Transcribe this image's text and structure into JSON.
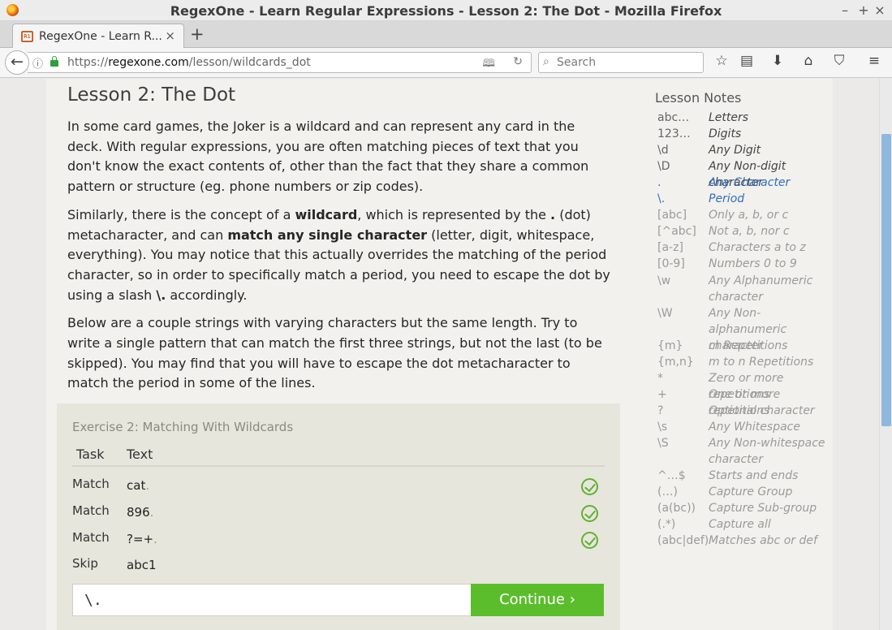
{
  "window": {
    "title": "RegexOne - Learn Regular Expressions - Lesson 2: The Dot - Mozilla Firefox",
    "minimize": "–",
    "maximize": "+",
    "close": "×"
  },
  "tab": {
    "favicon": "R1",
    "label": "RegexOne - Learn R...",
    "close": "×",
    "new_tab": "+"
  },
  "nav": {
    "back": "←",
    "info_icon": "ⓘ",
    "url_prefix": "https://",
    "url_domain": "regexone.com",
    "url_path": "/lesson/wildcards_dot",
    "reader_icon": "reader-view-icon",
    "reload_icon": "↻",
    "search_placeholder": "Search",
    "search_icon": "⌕",
    "toolbar_icons": [
      "☆",
      "▤",
      "⬇",
      "⌂",
      "⛉",
      "≡"
    ]
  },
  "lesson": {
    "title": "Lesson 2: The Dot",
    "p1": "In some card games, the Joker is a wildcard and can represent any card in the deck. With regular expressions, you are often matching pieces of text that you don't know the exact contents of, other than the fact that they share a common pattern or structure (eg. phone numbers or zip codes).",
    "p2a": "Similarly, there is the concept of a ",
    "p2b": "wildcard",
    "p2c": ", which is represented by the ",
    "p2d": ".",
    "p2e": " (dot) metacharacter, and can ",
    "p2f": "match any single character",
    "p2g": " (letter, digit, whitespace, everything). You may notice that this actually overrides the matching of the period character, so in order to specifically match a period, you need to escape the dot by using a slash ",
    "p2h": "\\.",
    "p2i": " accordingly.",
    "p3": "Below are a couple strings with varying characters but the same length. Try to write a single pattern that can match the first three strings, but not the last (to be skipped). You may find that you will have to escape the dot metacharacter to match the period in some of the lines."
  },
  "exercise": {
    "title": "Exercise 2: Matching With Wildcards",
    "col_task": "Task",
    "col_text": "Text",
    "rows": [
      {
        "task": "Match",
        "text": "cat",
        "hl": ".",
        "status": "success"
      },
      {
        "task": "Match",
        "text": "896",
        "hl": ".",
        "status": "success"
      },
      {
        "task": "Match",
        "text": "?=+",
        "hl": ".",
        "status": "success"
      },
      {
        "task": "Skip",
        "text": "abc1",
        "hl": "",
        "status": "none"
      }
    ],
    "answer_value": "\\.",
    "continue_label": "Continue ›"
  },
  "notes": {
    "title": "Lesson Notes",
    "items": [
      {
        "sym": "abc…",
        "desc": "Letters",
        "state": "learned"
      },
      {
        "sym": "123…",
        "desc": "Digits",
        "state": "learned"
      },
      {
        "sym": "\\d",
        "desc": "Any Digit",
        "state": "learned"
      },
      {
        "sym": "\\D",
        "desc": "Any Non-digit character",
        "state": "learned"
      },
      {
        "sym": ".",
        "desc": "Any Character",
        "state": "current"
      },
      {
        "sym": "\\.",
        "desc": "Period",
        "state": "current"
      },
      {
        "sym": "[abc]",
        "desc": "Only a, b, or c",
        "state": "future"
      },
      {
        "sym": "[^abc]",
        "desc": "Not a, b, nor c",
        "state": "future"
      },
      {
        "sym": "[a-z]",
        "desc": "Characters a to z",
        "state": "future"
      },
      {
        "sym": "[0-9]",
        "desc": "Numbers 0 to 9",
        "state": "future"
      },
      {
        "sym": "\\w",
        "desc": "Any Alphanumeric character",
        "state": "future"
      },
      {
        "sym": "\\W",
        "desc": "Any Non-alphanumeric character",
        "state": "future"
      },
      {
        "sym": "{m}",
        "desc": "m Repetitions",
        "state": "future"
      },
      {
        "sym": "{m,n}",
        "desc": "m to n Repetitions",
        "state": "future"
      },
      {
        "sym": "*",
        "desc": "Zero or more repetitions",
        "state": "future"
      },
      {
        "sym": "+",
        "desc": "One or more repetitions",
        "state": "future"
      },
      {
        "sym": "?",
        "desc": "Optional character",
        "state": "future"
      },
      {
        "sym": "\\s",
        "desc": "Any Whitespace",
        "state": "future"
      },
      {
        "sym": "\\S",
        "desc": "Any Non-whitespace character",
        "state": "future"
      },
      {
        "sym": "^…$",
        "desc": "Starts and ends",
        "state": "future"
      },
      {
        "sym": "(…)",
        "desc": "Capture Group",
        "state": "future"
      },
      {
        "sym": "(a(bc))",
        "desc": "Capture Sub-group",
        "state": "future"
      },
      {
        "sym": "(.*)",
        "desc": "Capture all",
        "state": "future"
      },
      {
        "sym": "(abc|def)",
        "desc": "Matches abc or def",
        "state": "future"
      }
    ]
  },
  "colors": {
    "success": "#5fb130",
    "continue_bg": "#5bbd2c",
    "current_note": "#2f6fbf"
  }
}
